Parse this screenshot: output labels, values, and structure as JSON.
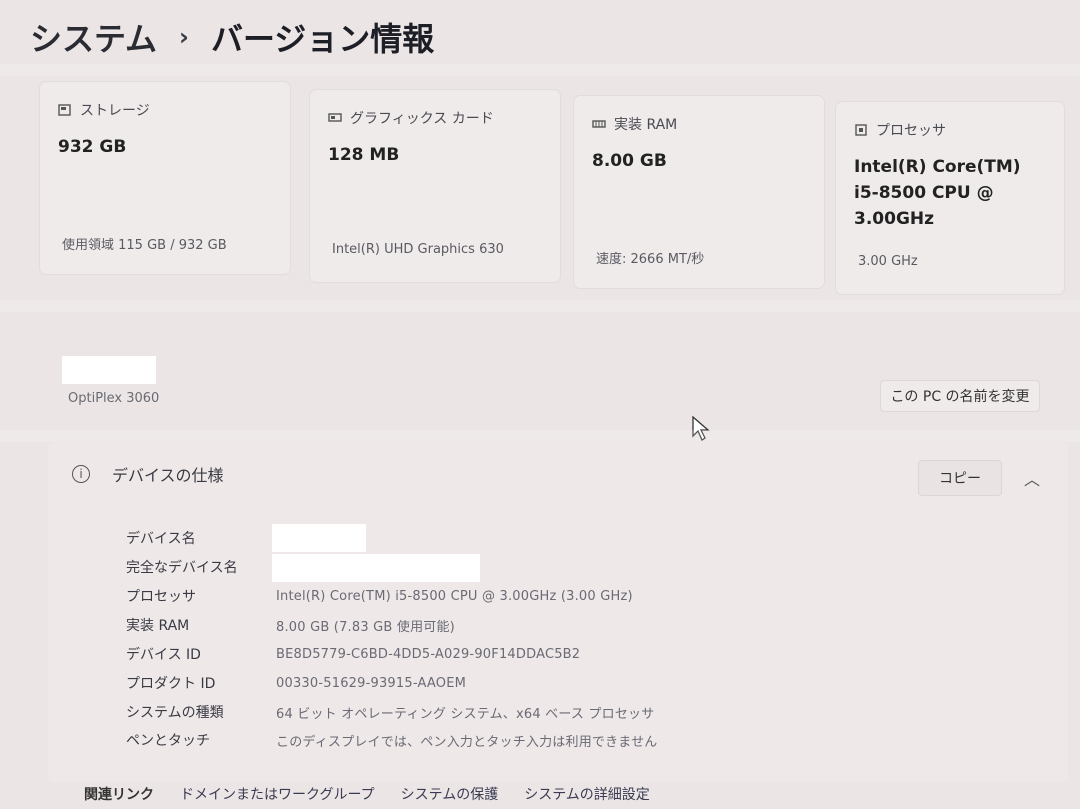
{
  "breadcrumb": {
    "root": "システム",
    "separator": "›",
    "current": "バージョン情報"
  },
  "cards": [
    {
      "icon": "storage-icon",
      "title": "ストレージ",
      "value": "932 GB",
      "detail": "使用領域 115 GB / 932 GB"
    },
    {
      "icon": "graphics-card-icon",
      "title": "グラフィックス カード",
      "value": "128 MB",
      "detail": "Intel(R) UHD Graphics 630"
    },
    {
      "icon": "ram-icon",
      "title": "実装 RAM",
      "value": "8.00 GB",
      "detail": "速度: 2666 MT/秒"
    },
    {
      "icon": "processor-icon",
      "title": "プロセッサ",
      "value": "Intel(R) Core(TM) i5-8500 CPU @ 3.00GHz",
      "detail": "3.00 GHz"
    }
  ],
  "device": {
    "model": "OptiPlex 3060",
    "rename_label": "この PC の名前を変更"
  },
  "specs": {
    "title": "デバイスの仕様",
    "copy_label": "コピー",
    "rows": [
      {
        "label": "デバイス名",
        "value": ""
      },
      {
        "label": "完全なデバイス名",
        "value": ""
      },
      {
        "label": "プロセッサ",
        "value": "Intel(R) Core(TM) i5-8500 CPU @ 3.00GHz (3.00 GHz)"
      },
      {
        "label": "実装 RAM",
        "value": "8.00 GB (7.83 GB 使用可能)"
      },
      {
        "label": "デバイス ID",
        "value": "BE8D5779-C6BD-4DD5-A029-90F14DDAC5B2"
      },
      {
        "label": "プロダクト ID",
        "value": "00330-51629-93915-AAOEM"
      },
      {
        "label": "システムの種類",
        "value": "64 ビット オペレーティング システム、x64 ベース プロセッサ"
      },
      {
        "label": "ペンとタッチ",
        "value": "このディスプレイでは、ペン入力とタッチ入力は利用できません"
      }
    ]
  },
  "related": {
    "title": "関連リンク",
    "links": [
      "ドメインまたはワークグループ",
      "システムの保護",
      "システムの詳細設定"
    ]
  }
}
